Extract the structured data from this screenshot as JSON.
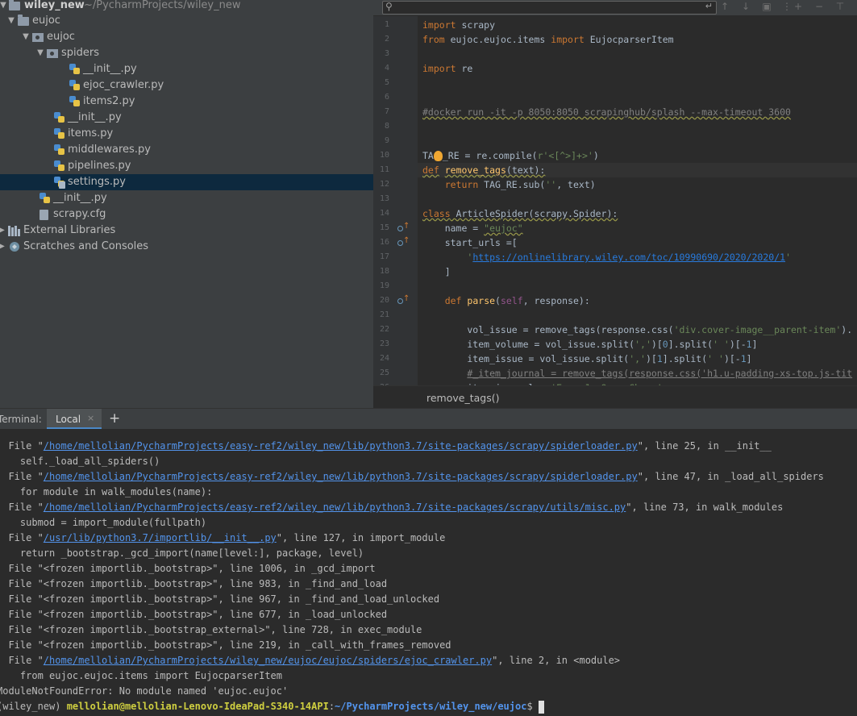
{
  "project": {
    "name": "wiley_new",
    "path": "~/PycharmProjects/wiley_new"
  },
  "tree": [
    {
      "label": "eujoc",
      "type": "folder",
      "depth": 1,
      "expanded": true
    },
    {
      "label": "eujoc",
      "type": "package",
      "depth": 2,
      "expanded": true
    },
    {
      "label": "spiders",
      "type": "package",
      "depth": 3,
      "expanded": true
    },
    {
      "label": "__init__.py",
      "type": "py",
      "depth": 4
    },
    {
      "label": "ejoc_crawler.py",
      "type": "py",
      "depth": 4
    },
    {
      "label": "items2.py",
      "type": "py",
      "depth": 4
    },
    {
      "label": "__init__.py",
      "type": "py",
      "depth": 3
    },
    {
      "label": "items.py",
      "type": "py",
      "depth": 3
    },
    {
      "label": "middlewares.py",
      "type": "py",
      "depth": 3
    },
    {
      "label": "pipelines.py",
      "type": "py",
      "depth": 3
    },
    {
      "label": "settings.py",
      "type": "pyg",
      "depth": 3,
      "selected": true
    },
    {
      "label": "__init__.py",
      "type": "py",
      "depth": 2
    },
    {
      "label": "scrapy.cfg",
      "type": "cfg",
      "depth": 2
    }
  ],
  "external_libraries": "External Libraries",
  "scratches": "Scratches and Consoles",
  "search": {
    "placeholder": "",
    "icon": "search-icon"
  },
  "code": {
    "line_numbers": [
      "1",
      "2",
      "3",
      "4",
      "5",
      "6",
      "7",
      "8",
      "9",
      "10",
      "11",
      "12",
      "13",
      "14",
      "15",
      "16",
      "17",
      "18",
      "19",
      "20",
      "21",
      "22",
      "23",
      "24",
      "25",
      "26"
    ],
    "docker_comment": "#docker run -it -p 8050:8050 scrapinghub/splash --max-timeout 3600",
    "start_url": "https://onlinelibrary.wiley.com/toc/10990690/2020/2020/1",
    "name_value": "\"eujoc\"",
    "regex": "r'<[^>]+>'"
  },
  "breadcrumb": "remove_tags()",
  "terminal_header": {
    "title": "Terminal:",
    "tab": "Local",
    "close": "×",
    "add": "+"
  },
  "terminal": [
    {
      "pre": "  File \"",
      "link": "/home/mellolian/PycharmProjects/easy-ref2/wiley_new/lib/python3.7/site-packages/scrapy/spiderloader.py",
      "post": "\", line 25, in __init__"
    },
    {
      "pre": "    self._load_all_spiders()",
      "link": "",
      "post": ""
    },
    {
      "pre": "  File \"",
      "link": "/home/mellolian/PycharmProjects/easy-ref2/wiley_new/lib/python3.7/site-packages/scrapy/spiderloader.py",
      "post": "\", line 47, in _load_all_spiders"
    },
    {
      "pre": "    for module in walk_modules(name):",
      "link": "",
      "post": ""
    },
    {
      "pre": "  File \"",
      "link": "/home/mellolian/PycharmProjects/easy-ref2/wiley_new/lib/python3.7/site-packages/scrapy/utils/misc.py",
      "post": "\", line 73, in walk_modules"
    },
    {
      "pre": "    submod = import_module(fullpath)",
      "link": "",
      "post": ""
    },
    {
      "pre": "  File \"",
      "link": "/usr/lib/python3.7/importlib/__init__.py",
      "post": "\", line 127, in import_module"
    },
    {
      "pre": "    return _bootstrap._gcd_import(name[level:], package, level)",
      "link": "",
      "post": ""
    },
    {
      "pre": "  File \"<frozen importlib._bootstrap>\", line 1006, in _gcd_import",
      "link": "",
      "post": ""
    },
    {
      "pre": "  File \"<frozen importlib._bootstrap>\", line 983, in _find_and_load",
      "link": "",
      "post": ""
    },
    {
      "pre": "  File \"<frozen importlib._bootstrap>\", line 967, in _find_and_load_unlocked",
      "link": "",
      "post": ""
    },
    {
      "pre": "  File \"<frozen importlib._bootstrap>\", line 677, in _load_unlocked",
      "link": "",
      "post": ""
    },
    {
      "pre": "  File \"<frozen importlib._bootstrap_external>\", line 728, in exec_module",
      "link": "",
      "post": ""
    },
    {
      "pre": "  File \"<frozen importlib._bootstrap>\", line 219, in _call_with_frames_removed",
      "link": "",
      "post": ""
    },
    {
      "pre": "  File \"",
      "link": "/home/mellolian/PycharmProjects/wiley_new/eujoc/eujoc/spiders/ejoc_crawler.py",
      "post": "\", line 2, in <module>"
    },
    {
      "pre": "    from eujoc.eujoc.items import EujocparserItem",
      "link": "",
      "post": ""
    },
    {
      "pre": "ModuleNotFoundError: No module named 'eujoc.eujoc'",
      "link": "",
      "post": ""
    }
  ],
  "prompt": {
    "env": "(wiley_new) ",
    "user": "mellolian@mellolian-Lenovo-IdeaPad-S340-14API",
    "sep": ":",
    "path": "~/PycharmProjects/wiley_new/eujoc",
    "end": "$ "
  }
}
